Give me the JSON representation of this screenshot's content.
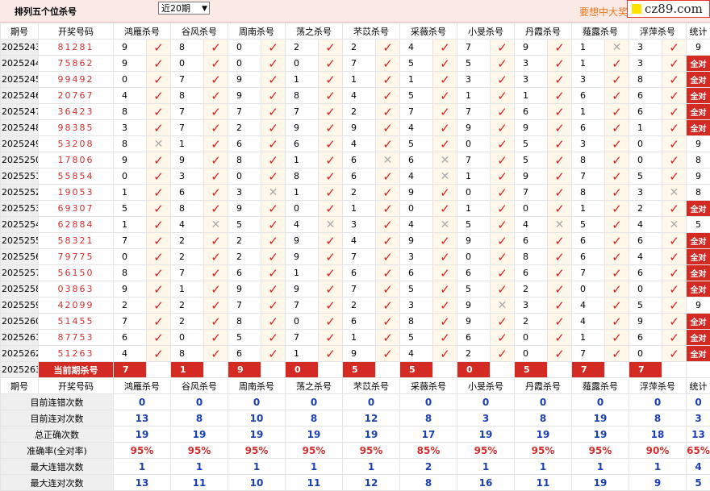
{
  "page": {
    "title": "排列五个位杀号",
    "period_select": "近20期",
    "promo_text": "要想中大奖",
    "logo_text": "cz89.com"
  },
  "table": {
    "headers": [
      "期号",
      "开奖号码",
      "鸿雁杀号",
      "谷风杀号",
      "周南杀号",
      "荡之杀号",
      "芣苡杀号",
      "采薇杀号",
      "小旻杀号",
      "丹霞杀号",
      "薤露杀号",
      "浮萍杀号",
      "统计"
    ],
    "rows": [
      {
        "phase": "2025243",
        "draw": "81281",
        "kills": [
          [
            "9",
            "v"
          ],
          [
            "8",
            "v"
          ],
          [
            "0",
            "v"
          ],
          [
            "2",
            "v"
          ],
          [
            "2",
            "v"
          ],
          [
            "4",
            "v"
          ],
          [
            "7",
            "v"
          ],
          [
            "9",
            "v"
          ],
          [
            "1",
            "x"
          ],
          [
            "3",
            "v"
          ]
        ],
        "stat": "9"
      },
      {
        "phase": "2025244",
        "draw": "75862",
        "kills": [
          [
            "9",
            "v"
          ],
          [
            "0",
            "v"
          ],
          [
            "0",
            "v"
          ],
          [
            "0",
            "v"
          ],
          [
            "7",
            "v"
          ],
          [
            "5",
            "v"
          ],
          [
            "5",
            "v"
          ],
          [
            "3",
            "v"
          ],
          [
            "1",
            "v"
          ],
          [
            "3",
            "v"
          ]
        ],
        "stat": "全对"
      },
      {
        "phase": "2025245",
        "draw": "99492",
        "kills": [
          [
            "0",
            "v"
          ],
          [
            "7",
            "v"
          ],
          [
            "9",
            "v"
          ],
          [
            "1",
            "v"
          ],
          [
            "1",
            "v"
          ],
          [
            "1",
            "v"
          ],
          [
            "3",
            "v"
          ],
          [
            "3",
            "v"
          ],
          [
            "3",
            "v"
          ],
          [
            "8",
            "v"
          ]
        ],
        "stat": "全对"
      },
      {
        "phase": "2025246",
        "draw": "20767",
        "kills": [
          [
            "4",
            "v"
          ],
          [
            "8",
            "v"
          ],
          [
            "9",
            "v"
          ],
          [
            "8",
            "v"
          ],
          [
            "4",
            "v"
          ],
          [
            "5",
            "v"
          ],
          [
            "1",
            "v"
          ],
          [
            "1",
            "v"
          ],
          [
            "6",
            "v"
          ],
          [
            "6",
            "v"
          ]
        ],
        "stat": "全对"
      },
      {
        "phase": "2025247",
        "draw": "36423",
        "kills": [
          [
            "8",
            "v"
          ],
          [
            "7",
            "v"
          ],
          [
            "7",
            "v"
          ],
          [
            "7",
            "v"
          ],
          [
            "2",
            "v"
          ],
          [
            "7",
            "v"
          ],
          [
            "7",
            "v"
          ],
          [
            "6",
            "v"
          ],
          [
            "1",
            "v"
          ],
          [
            "6",
            "v"
          ]
        ],
        "stat": "全对"
      },
      {
        "phase": "2025248",
        "draw": "98385",
        "kills": [
          [
            "3",
            "v"
          ],
          [
            "7",
            "v"
          ],
          [
            "2",
            "v"
          ],
          [
            "9",
            "v"
          ],
          [
            "9",
            "v"
          ],
          [
            "4",
            "v"
          ],
          [
            "9",
            "v"
          ],
          [
            "9",
            "v"
          ],
          [
            "6",
            "v"
          ],
          [
            "1",
            "v"
          ]
        ],
        "stat": "全对"
      },
      {
        "phase": "2025249",
        "draw": "53208",
        "kills": [
          [
            "8",
            "x"
          ],
          [
            "1",
            "v"
          ],
          [
            "6",
            "v"
          ],
          [
            "6",
            "v"
          ],
          [
            "4",
            "v"
          ],
          [
            "5",
            "v"
          ],
          [
            "0",
            "v"
          ],
          [
            "5",
            "v"
          ],
          [
            "3",
            "v"
          ],
          [
            "0",
            "v"
          ]
        ],
        "stat": "9"
      },
      {
        "phase": "2025250",
        "draw": "17806",
        "kills": [
          [
            "9",
            "v"
          ],
          [
            "9",
            "v"
          ],
          [
            "8",
            "v"
          ],
          [
            "1",
            "v"
          ],
          [
            "6",
            "x"
          ],
          [
            "6",
            "x"
          ],
          [
            "7",
            "v"
          ],
          [
            "5",
            "v"
          ],
          [
            "8",
            "v"
          ],
          [
            "0",
            "v"
          ]
        ],
        "stat": "8"
      },
      {
        "phase": "2025251",
        "draw": "55854",
        "kills": [
          [
            "0",
            "v"
          ],
          [
            "3",
            "v"
          ],
          [
            "0",
            "v"
          ],
          [
            "8",
            "v"
          ],
          [
            "6",
            "v"
          ],
          [
            "4",
            "x"
          ],
          [
            "1",
            "v"
          ],
          [
            "9",
            "v"
          ],
          [
            "7",
            "v"
          ],
          [
            "5",
            "v"
          ]
        ],
        "stat": "9"
      },
      {
        "phase": "2025252",
        "draw": "19053",
        "kills": [
          [
            "1",
            "v"
          ],
          [
            "6",
            "v"
          ],
          [
            "3",
            "x"
          ],
          [
            "1",
            "v"
          ],
          [
            "2",
            "v"
          ],
          [
            "9",
            "v"
          ],
          [
            "0",
            "v"
          ],
          [
            "7",
            "v"
          ],
          [
            "8",
            "v"
          ],
          [
            "3",
            "x"
          ]
        ],
        "stat": "8"
      },
      {
        "phase": "2025253",
        "draw": "69307",
        "kills": [
          [
            "5",
            "v"
          ],
          [
            "8",
            "v"
          ],
          [
            "9",
            "v"
          ],
          [
            "0",
            "v"
          ],
          [
            "1",
            "v"
          ],
          [
            "0",
            "v"
          ],
          [
            "1",
            "v"
          ],
          [
            "0",
            "v"
          ],
          [
            "1",
            "v"
          ],
          [
            "2",
            "v"
          ]
        ],
        "stat": "全对"
      },
      {
        "phase": "2025254",
        "draw": "62884",
        "kills": [
          [
            "1",
            "v"
          ],
          [
            "4",
            "x"
          ],
          [
            "5",
            "v"
          ],
          [
            "4",
            "x"
          ],
          [
            "3",
            "v"
          ],
          [
            "4",
            "x"
          ],
          [
            "5",
            "v"
          ],
          [
            "4",
            "x"
          ],
          [
            "5",
            "v"
          ],
          [
            "4",
            "x"
          ]
        ],
        "stat": "5"
      },
      {
        "phase": "2025255",
        "draw": "58321",
        "kills": [
          [
            "7",
            "v"
          ],
          [
            "2",
            "v"
          ],
          [
            "2",
            "v"
          ],
          [
            "9",
            "v"
          ],
          [
            "4",
            "v"
          ],
          [
            "9",
            "v"
          ],
          [
            "9",
            "v"
          ],
          [
            "6",
            "v"
          ],
          [
            "6",
            "v"
          ],
          [
            "6",
            "v"
          ]
        ],
        "stat": "全对"
      },
      {
        "phase": "2025256",
        "draw": "79775",
        "kills": [
          [
            "0",
            "v"
          ],
          [
            "2",
            "v"
          ],
          [
            "2",
            "v"
          ],
          [
            "9",
            "v"
          ],
          [
            "7",
            "v"
          ],
          [
            "3",
            "v"
          ],
          [
            "0",
            "v"
          ],
          [
            "8",
            "v"
          ],
          [
            "6",
            "v"
          ],
          [
            "4",
            "v"
          ]
        ],
        "stat": "全对"
      },
      {
        "phase": "2025257",
        "draw": "56150",
        "kills": [
          [
            "8",
            "v"
          ],
          [
            "7",
            "v"
          ],
          [
            "6",
            "v"
          ],
          [
            "1",
            "v"
          ],
          [
            "6",
            "v"
          ],
          [
            "6",
            "v"
          ],
          [
            "6",
            "v"
          ],
          [
            "6",
            "v"
          ],
          [
            "7",
            "v"
          ],
          [
            "6",
            "v"
          ]
        ],
        "stat": "全对"
      },
      {
        "phase": "2025258",
        "draw": "03863",
        "kills": [
          [
            "9",
            "v"
          ],
          [
            "1",
            "v"
          ],
          [
            "9",
            "v"
          ],
          [
            "9",
            "v"
          ],
          [
            "7",
            "v"
          ],
          [
            "5",
            "v"
          ],
          [
            "5",
            "v"
          ],
          [
            "2",
            "v"
          ],
          [
            "0",
            "v"
          ],
          [
            "0",
            "v"
          ]
        ],
        "stat": "全对"
      },
      {
        "phase": "2025259",
        "draw": "42099",
        "kills": [
          [
            "2",
            "v"
          ],
          [
            "2",
            "v"
          ],
          [
            "7",
            "v"
          ],
          [
            "7",
            "v"
          ],
          [
            "2",
            "v"
          ],
          [
            "3",
            "v"
          ],
          [
            "9",
            "x"
          ],
          [
            "3",
            "v"
          ],
          [
            "4",
            "v"
          ],
          [
            "5",
            "v"
          ]
        ],
        "stat": "9"
      },
      {
        "phase": "2025260",
        "draw": "51455",
        "kills": [
          [
            "7",
            "v"
          ],
          [
            "2",
            "v"
          ],
          [
            "8",
            "v"
          ],
          [
            "0",
            "v"
          ],
          [
            "6",
            "v"
          ],
          [
            "8",
            "v"
          ],
          [
            "9",
            "v"
          ],
          [
            "2",
            "v"
          ],
          [
            "4",
            "v"
          ],
          [
            "9",
            "v"
          ]
        ],
        "stat": "全对"
      },
      {
        "phase": "2025261",
        "draw": "87753",
        "kills": [
          [
            "6",
            "v"
          ],
          [
            "0",
            "v"
          ],
          [
            "5",
            "v"
          ],
          [
            "7",
            "v"
          ],
          [
            "1",
            "v"
          ],
          [
            "5",
            "v"
          ],
          [
            "6",
            "v"
          ],
          [
            "0",
            "v"
          ],
          [
            "1",
            "v"
          ],
          [
            "6",
            "v"
          ]
        ],
        "stat": "全对"
      },
      {
        "phase": "2025262",
        "draw": "51263",
        "kills": [
          [
            "4",
            "v"
          ],
          [
            "8",
            "v"
          ],
          [
            "6",
            "v"
          ],
          [
            "1",
            "v"
          ],
          [
            "9",
            "v"
          ],
          [
            "4",
            "v"
          ],
          [
            "2",
            "v"
          ],
          [
            "0",
            "v"
          ],
          [
            "7",
            "v"
          ],
          [
            "0",
            "v"
          ]
        ],
        "stat": "全对"
      }
    ],
    "current": {
      "phase": "2025263",
      "label": "当前期杀号",
      "kills": [
        "7",
        "1",
        "9",
        "0",
        "5",
        "5",
        "0",
        "5",
        "7",
        "7"
      ]
    },
    "stats": [
      {
        "label": "目前连错次数",
        "values": [
          "0",
          "0",
          "0",
          "0",
          "0",
          "0",
          "0",
          "0",
          "0",
          "0",
          "0"
        ]
      },
      {
        "label": "目前连对次数",
        "values": [
          "13",
          "8",
          "10",
          "8",
          "12",
          "8",
          "3",
          "8",
          "19",
          "8",
          "3"
        ]
      },
      {
        "label": "总正确次数",
        "values": [
          "19",
          "19",
          "19",
          "19",
          "19",
          "17",
          "19",
          "19",
          "19",
          "18",
          "13"
        ]
      },
      {
        "label": "准确率(全对率)",
        "values": [
          "95%",
          "95%",
          "95%",
          "95%",
          "95%",
          "85%",
          "95%",
          "95%",
          "95%",
          "90%",
          "65%"
        ],
        "red": true
      },
      {
        "label": "最大连错次数",
        "values": [
          "1",
          "1",
          "1",
          "1",
          "1",
          "2",
          "1",
          "1",
          "1",
          "1",
          "4"
        ]
      },
      {
        "label": "最大连对次数",
        "values": [
          "13",
          "11",
          "10",
          "11",
          "12",
          "8",
          "16",
          "11",
          "19",
          "9",
          "5"
        ]
      }
    ]
  }
}
